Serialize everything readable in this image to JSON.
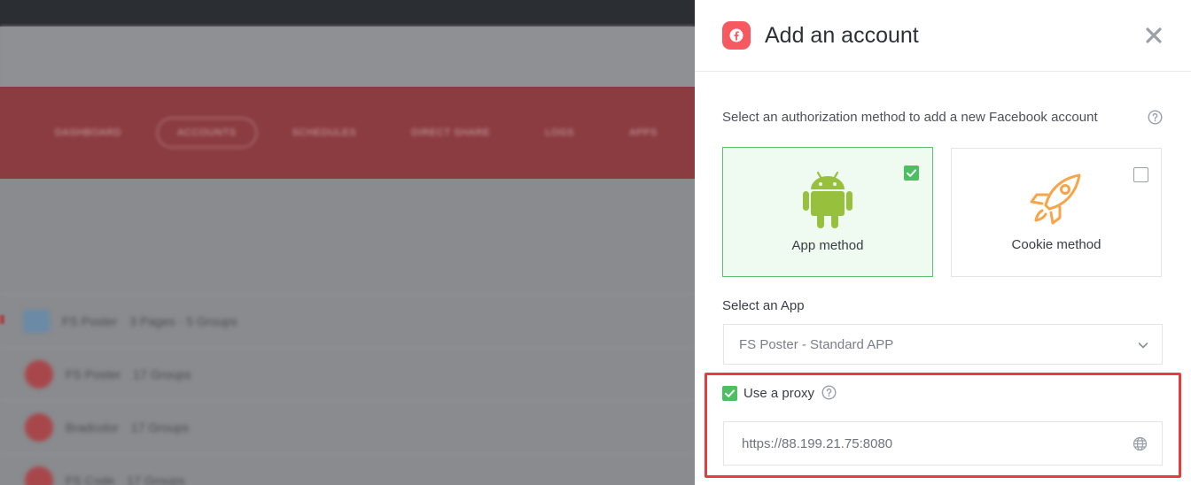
{
  "background": {
    "nav": [
      "DASHBOARD",
      "ACCOUNTS",
      "SCHEDULES",
      "DIRECT SHARE",
      "LOGS",
      "APPS"
    ],
    "rows": [
      {
        "name": "FS Poster",
        "meta": "3 Pages · 5 Groups"
      },
      {
        "name": "FS Poster",
        "meta": "17 Groups"
      },
      {
        "name": "Bradcolor",
        "meta": "17 Groups"
      },
      {
        "name": "FS Code",
        "meta": "17 Groups"
      }
    ]
  },
  "panel": {
    "title": "Add an account",
    "brand_icon": "facebook-icon",
    "close_icon": "close-icon",
    "prompt": "Select an authorization method to add a new Facebook account",
    "methods": [
      {
        "label": "App method",
        "icon": "android-icon",
        "selected": true
      },
      {
        "label": "Cookie method",
        "icon": "rocket-icon",
        "selected": false
      }
    ],
    "app_label": "Select an App",
    "app_value": "FS Poster - Standard APP",
    "proxy_label": "Use a proxy",
    "proxy_checked": true,
    "proxy_value": "https://88.199.21.75:8080"
  },
  "colors": {
    "accent": "#f6595f",
    "selected_border": "#58c26c",
    "check": "#4cbf62",
    "highlight": "#e53e3e",
    "android": "#97c03d",
    "rocket": "#f6a54a"
  }
}
